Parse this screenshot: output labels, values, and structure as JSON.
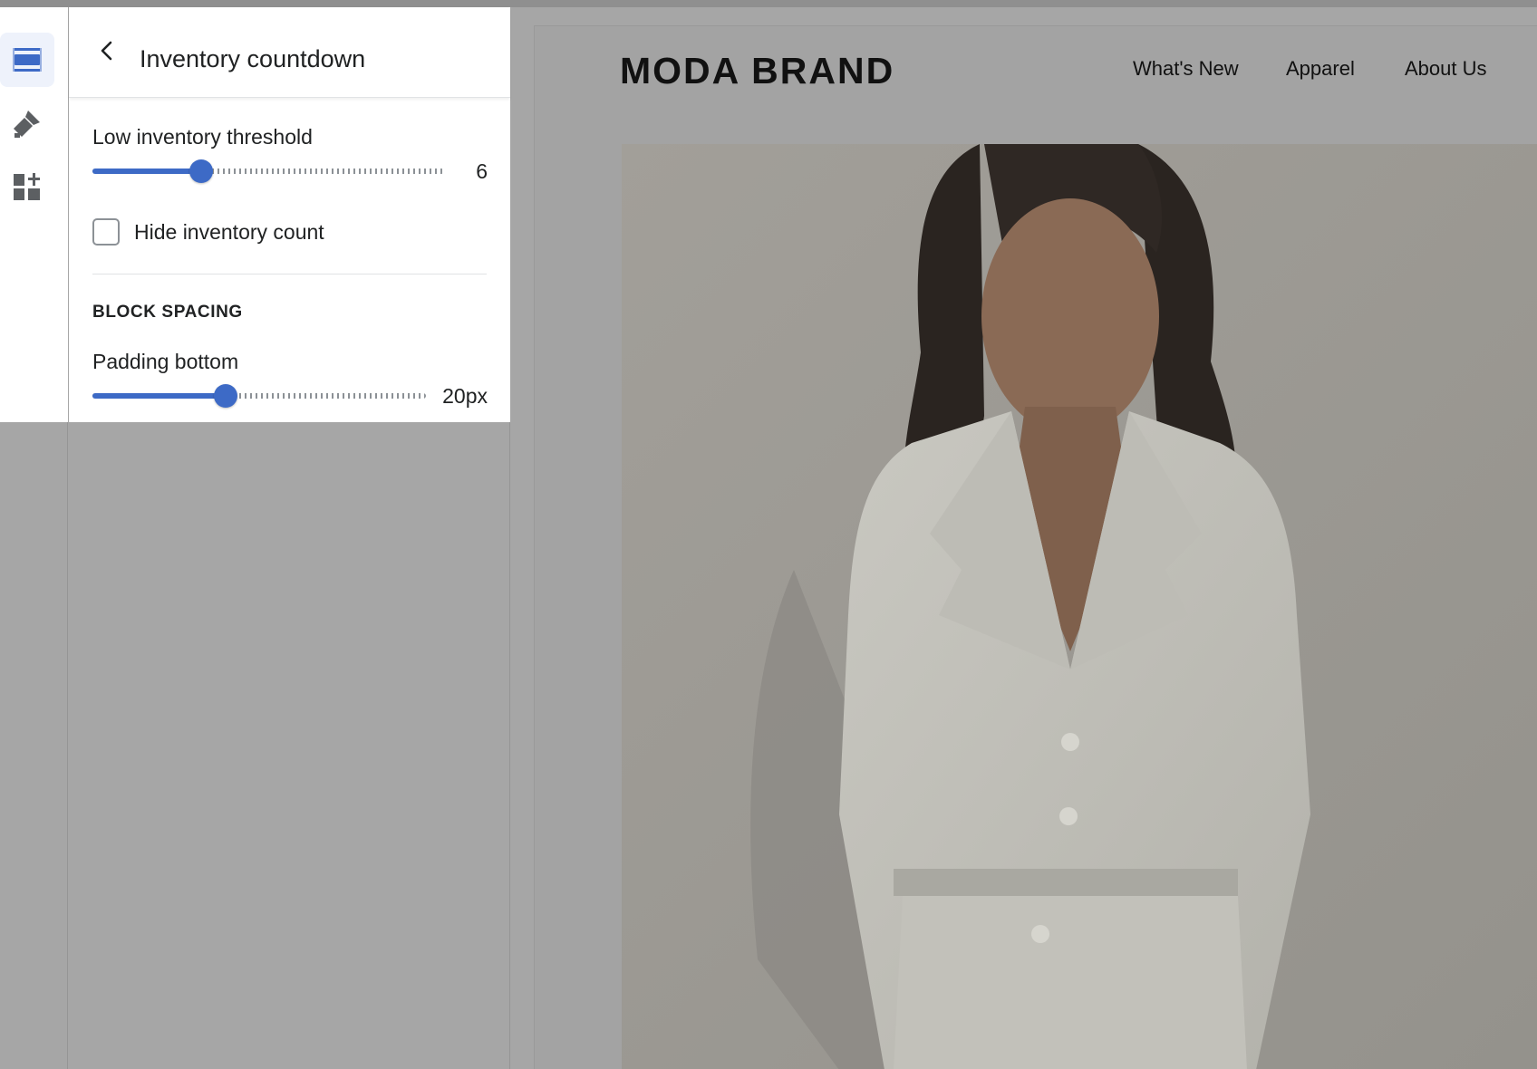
{
  "sidebar": {
    "items": [
      {
        "icon": "sections-icon",
        "active": true
      },
      {
        "icon": "theme-brush-icon",
        "active": false
      },
      {
        "icon": "add-block-icon",
        "active": false
      }
    ]
  },
  "panel": {
    "title": "Inventory countdown",
    "threshold": {
      "label": "Low inventory threshold",
      "value": "6",
      "level": 0.31
    },
    "hide_count": {
      "label": "Hide inventory count",
      "checked": false
    },
    "section_heading": "BLOCK SPACING",
    "padding": {
      "label": "Padding bottom",
      "value": "20px",
      "level": 0.4
    }
  },
  "preview": {
    "brand": "MODA BRAND",
    "nav": [
      "What's New",
      "Apparel",
      "About Us"
    ],
    "image_alt": "Model wearing a white cropped blazer and trousers"
  },
  "colors": {
    "accent": "#3d6ac6",
    "overlay": "#a6a6a6",
    "panel_bg": "#ffffff"
  }
}
